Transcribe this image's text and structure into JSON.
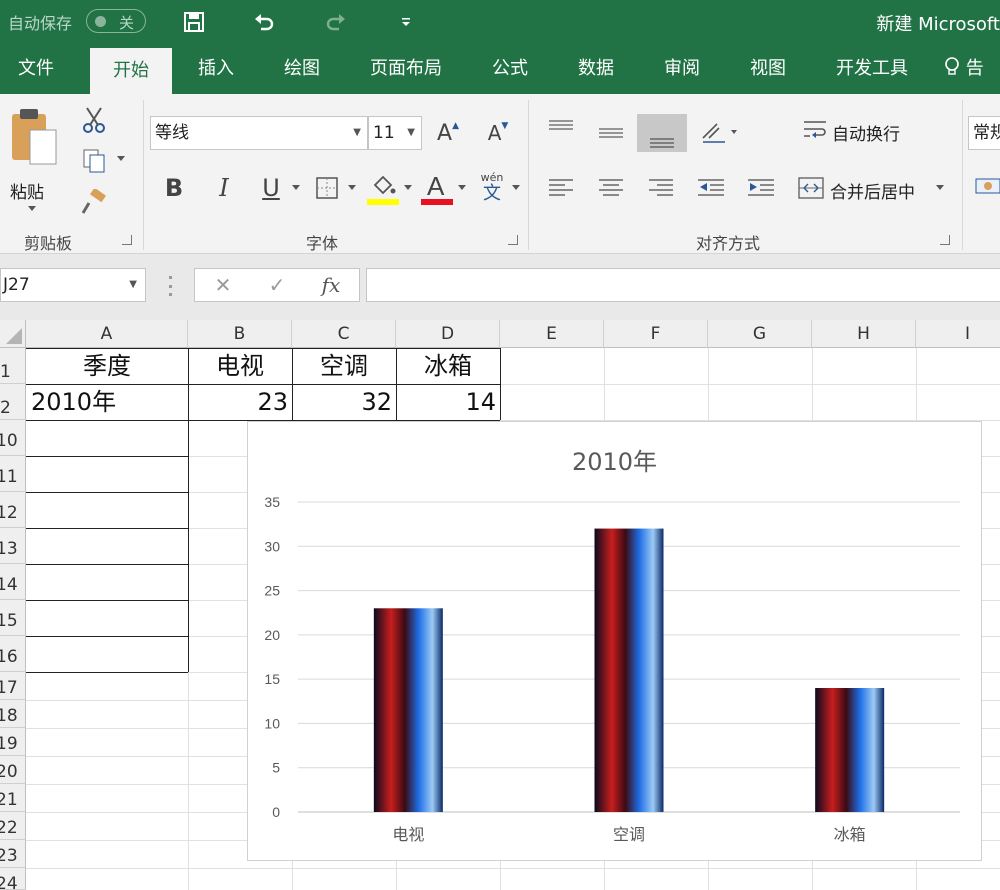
{
  "titlebar": {
    "autosave_label": "自动保存",
    "autosave_state": "关",
    "doc_title": "新建 Microsoft"
  },
  "tabs": [
    "文件",
    "开始",
    "插入",
    "绘图",
    "页面布局",
    "公式",
    "数据",
    "审阅",
    "视图",
    "开发工具",
    "告诉"
  ],
  "active_tab": "开始",
  "ribbon": {
    "clipboard": {
      "label": "剪贴板",
      "paste": "粘贴"
    },
    "font": {
      "label": "字体",
      "font_name": "等线",
      "font_size": "11",
      "phonetic_top": "wén",
      "phonetic_bottom": "文"
    },
    "alignment": {
      "label": "对齐方式",
      "wrap_text": "自动换行",
      "merge_center": "合并后居中"
    },
    "number": {
      "format": "常规"
    }
  },
  "formula_bar": {
    "name_box": "J27",
    "fx": "fx",
    "formula": ""
  },
  "columns": [
    "A",
    "B",
    "C",
    "D",
    "E",
    "F",
    "G",
    "H",
    "I"
  ],
  "rows": [
    "1",
    "2",
    "10",
    "11",
    "12",
    "13",
    "14",
    "15",
    "16",
    "17",
    "18",
    "19",
    "20",
    "21",
    "22",
    "23",
    "24"
  ],
  "cells": {
    "A1": "季度",
    "B1": "电视",
    "C1": "空调",
    "D1": "冰箱",
    "A2": "2010年",
    "B2": "23",
    "C2": "32",
    "D2": "14"
  },
  "chart_data": {
    "type": "bar",
    "title": "2010年",
    "categories": [
      "电视",
      "空调",
      "冰箱"
    ],
    "values": [
      23,
      32,
      14
    ],
    "ylim": [
      0,
      35
    ],
    "yticks": [
      "0",
      "5",
      "10",
      "15",
      "20",
      "25",
      "30",
      "35"
    ],
    "grid": true,
    "bar_fill": "picture",
    "bar_colors": [
      "#c81e1e",
      "#1e6ee6",
      "#0a0a1e"
    ]
  },
  "colors": {
    "accent": "#217346",
    "ribbon_bg": "#f3f3f3"
  }
}
